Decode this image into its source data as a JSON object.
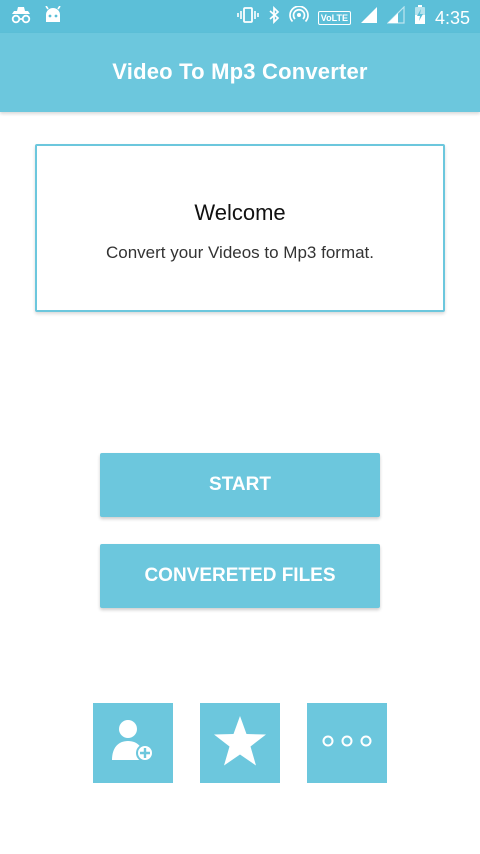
{
  "status_bar": {
    "left_icons": [
      "incognito-icon",
      "android-icon"
    ],
    "right_icons": [
      "vibrate-icon",
      "bluetooth-icon",
      "hotspot-icon",
      "volte-icon",
      "signal-icon",
      "signal-weak-icon",
      "battery-charging-icon"
    ],
    "volte_label": "VoLTE",
    "time": "4:35"
  },
  "app_bar": {
    "title": "Video To Mp3 Converter"
  },
  "welcome_card": {
    "title": "Welcome",
    "subtitle": "Convert your Videos to Mp3 format."
  },
  "buttons": {
    "start": "START",
    "converted_files": "CONVERETED FILES"
  },
  "bottom_icons": [
    "add-user-icon",
    "star-icon",
    "more-icon"
  ],
  "colors": {
    "status_bar": "#5cbfd8",
    "primary": "#6cc7dd",
    "background": "#ffffff"
  }
}
